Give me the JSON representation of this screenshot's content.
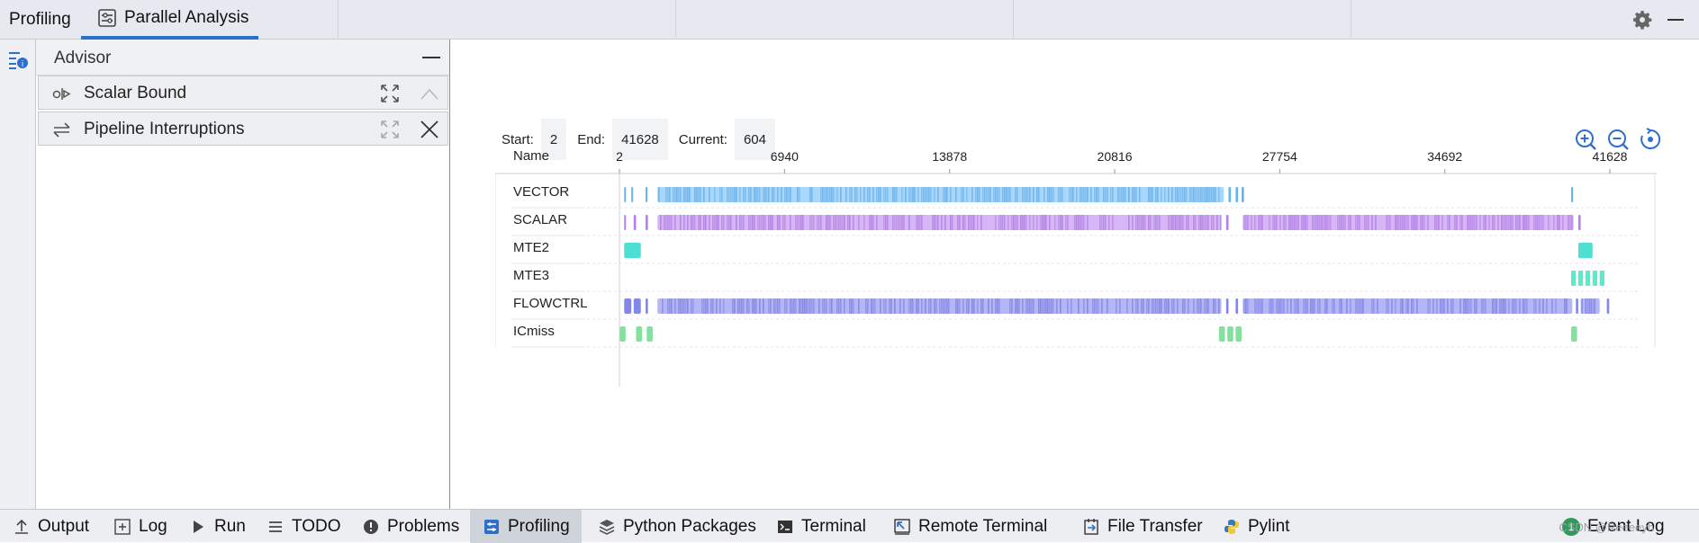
{
  "top_tabs": [
    {
      "label": "Profiling",
      "active": false
    },
    {
      "label": "Parallel Analysis",
      "active": true
    }
  ],
  "advisor": {
    "title": "Advisor",
    "items": [
      {
        "label": "Scalar Bound"
      },
      {
        "label": "Pipeline Interruptions"
      }
    ]
  },
  "range": {
    "start_label": "Start:",
    "start_value": "2",
    "end_label": "End:",
    "end_value": "41628",
    "current_label": "Current:",
    "current_value": "604"
  },
  "chart_data": {
    "type": "timeline",
    "name_header": "Name",
    "x_ticks": [
      "2",
      "6940",
      "13878",
      "20816",
      "27754",
      "34692",
      "41628"
    ],
    "xlim": [
      2,
      41628
    ],
    "rows": [
      {
        "name": "VECTOR",
        "color": "#4aa8f0",
        "light": "#a9d6fb",
        "segments": [
          [
            200,
            260
          ],
          [
            500,
            560
          ],
          [
            1100,
            1160
          ],
          [
            1600,
            25400
          ],
          [
            25600,
            25700
          ],
          [
            25900,
            26000
          ],
          [
            26150,
            26250
          ],
          [
            40000,
            40080
          ]
        ]
      },
      {
        "name": "SCALAR",
        "color": "#a86ae8",
        "light": "#d6b6f6",
        "segments": [
          [
            200,
            260
          ],
          [
            600,
            700
          ],
          [
            1100,
            1200
          ],
          [
            1600,
            25300
          ],
          [
            25500,
            25600
          ],
          [
            26200,
            40100
          ],
          [
            40300,
            40400
          ]
        ]
      },
      {
        "name": "MTE2",
        "color": "#2ed9cc",
        "light": "#7cece3",
        "segments": [
          [
            200,
            900
          ],
          [
            40300,
            40900
          ]
        ]
      },
      {
        "name": "MTE3",
        "color": "#3ee6c4",
        "light": "#8cf2dc",
        "segments": [
          [
            40000,
            40200
          ],
          [
            40300,
            40500
          ],
          [
            40600,
            40800
          ],
          [
            40900,
            41100
          ],
          [
            41200,
            41400
          ]
        ]
      },
      {
        "name": "FLOWCTRL",
        "color": "#6f72e6",
        "light": "#b4b6f6",
        "segments": [
          [
            200,
            500
          ],
          [
            600,
            900
          ],
          [
            1100,
            1200
          ],
          [
            1600,
            25300
          ],
          [
            25500,
            25600
          ],
          [
            25900,
            26000
          ],
          [
            26200,
            40050
          ],
          [
            40200,
            40300
          ],
          [
            40400,
            41200
          ],
          [
            41500,
            41600
          ]
        ]
      },
      {
        "name": "ICmiss",
        "color": "#6fdc8c",
        "light": "#a8ecb8",
        "segments": [
          [
            20,
            260
          ],
          [
            700,
            950
          ],
          [
            1150,
            1400
          ],
          [
            25200,
            25450
          ],
          [
            25550,
            25800
          ],
          [
            25900,
            26150
          ],
          [
            40000,
            40250
          ]
        ]
      }
    ]
  },
  "bottom_tabs": [
    {
      "label": "Output",
      "icon": "upload-icon"
    },
    {
      "label": "Log",
      "icon": "plus-box-icon"
    },
    {
      "label": "Run",
      "icon": "play-icon"
    },
    {
      "label": "TODO",
      "icon": "list-icon"
    },
    {
      "label": "Problems",
      "icon": "alert-circle-icon"
    },
    {
      "label": "Profiling",
      "icon": "profiling-icon",
      "active": true
    },
    {
      "label": "Python Packages",
      "icon": "layers-icon"
    },
    {
      "label": "Terminal",
      "icon": "terminal-icon"
    },
    {
      "label": "Remote Terminal",
      "icon": "remote-terminal-icon"
    },
    {
      "label": "File Transfer",
      "icon": "file-transfer-icon"
    },
    {
      "label": "Pylint",
      "icon": "python-icon"
    },
    {
      "label": "Event Log",
      "icon": "event-log-icon",
      "badge": "1"
    }
  ],
  "watermark": "CSDN @Reeeeyh",
  "colors": {
    "accent": "#2f6fcc"
  }
}
